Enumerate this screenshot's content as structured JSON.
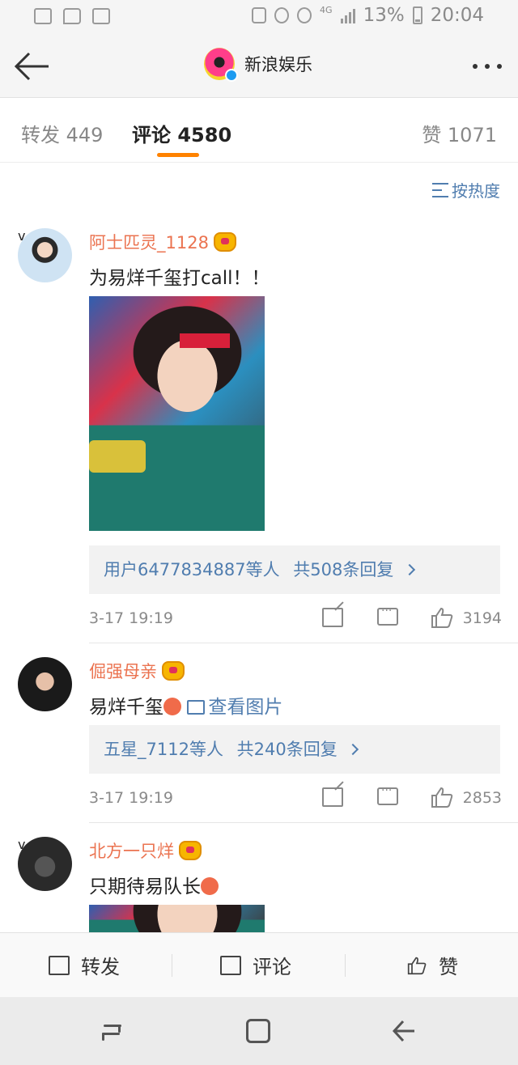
{
  "status_bar": {
    "network": "4G",
    "battery": "13%",
    "time": "20:04"
  },
  "header": {
    "title": "新浪娱乐"
  },
  "tabs": {
    "repost": "转发 449",
    "comment": "评论 4580",
    "like": "赞 1071"
  },
  "sort_label": "按热度",
  "comments": [
    {
      "username": "阿士匹灵_1128",
      "text": "为易烊千玺打call！！",
      "reply_users": "用户6477834887等人",
      "reply_count": "共508条回复",
      "time": "3-17 19:19",
      "likes": "3194"
    },
    {
      "username": "倔强母亲",
      "text": "易烊千玺",
      "image_link": "查看图片",
      "reply_users": "五星_7112等人",
      "reply_count": "共240条回复",
      "time": "3-17 19:19",
      "likes": "2853"
    },
    {
      "username": "北方一只烊",
      "text": "只期待易队长"
    }
  ],
  "action_bar": {
    "repost": "转发",
    "comment": "评论",
    "like": "赞"
  },
  "colors": {
    "accent_orange": "#ff8200",
    "username": "#eb7350",
    "link_blue": "#507daf"
  }
}
